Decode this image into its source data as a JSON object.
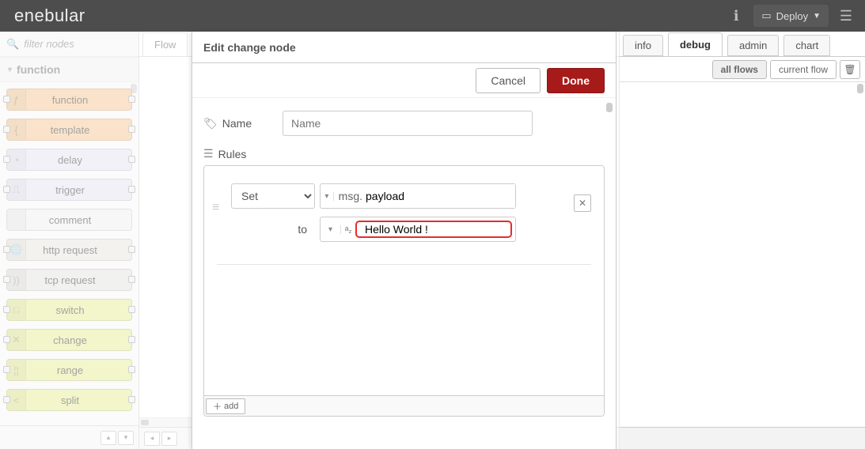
{
  "brand": "enebular",
  "header": {
    "deploy_label": "Deploy"
  },
  "palette": {
    "search_placeholder": "filter nodes",
    "category": "function",
    "nodes": [
      {
        "label": "function",
        "css": "node-orange",
        "icon": "ƒ",
        "in": true,
        "out": true
      },
      {
        "label": "template",
        "css": "node-orange",
        "icon": "{",
        "in": true,
        "out": true
      },
      {
        "label": "delay",
        "css": "node-violet",
        "icon": "◔",
        "in": true,
        "out": true
      },
      {
        "label": "trigger",
        "css": "node-violet",
        "icon": "⎍",
        "in": true,
        "out": true
      },
      {
        "label": "comment",
        "css": "node-lightgrey",
        "icon": "",
        "in": false,
        "out": false
      },
      {
        "label": "http request",
        "css": "node-grey",
        "icon": "🌐",
        "in": true,
        "out": true
      },
      {
        "label": "tcp request",
        "css": "node-grey2",
        "icon": "))",
        "in": true,
        "out": true
      },
      {
        "label": "switch",
        "css": "node-yellow",
        "icon": "⎌",
        "in": true,
        "out": true
      },
      {
        "label": "change",
        "css": "node-yellow",
        "icon": "✕",
        "in": true,
        "out": true
      },
      {
        "label": "range",
        "css": "node-yellow",
        "icon": "¦¦",
        "in": true,
        "out": true
      },
      {
        "label": "split",
        "css": "node-yellow",
        "icon": "<",
        "in": true,
        "out": true
      }
    ]
  },
  "workspace": {
    "tab_label": "Flow"
  },
  "sidebar": {
    "tabs": {
      "info": "info",
      "debug": "debug",
      "admin": "admin",
      "chart": "chart"
    },
    "buttons": {
      "all_flows": "all flows",
      "current_flow": "current flow"
    }
  },
  "tray": {
    "title": "Edit change node",
    "cancel": "Cancel",
    "done": "Done",
    "name_label": "Name",
    "name_placeholder": "Name",
    "rules_label": "Rules",
    "rule": {
      "action": "Set",
      "msg_prefix": "msg.",
      "property": "payload",
      "to_label": "to",
      "value": "Hello World !"
    },
    "add_label": "add"
  }
}
